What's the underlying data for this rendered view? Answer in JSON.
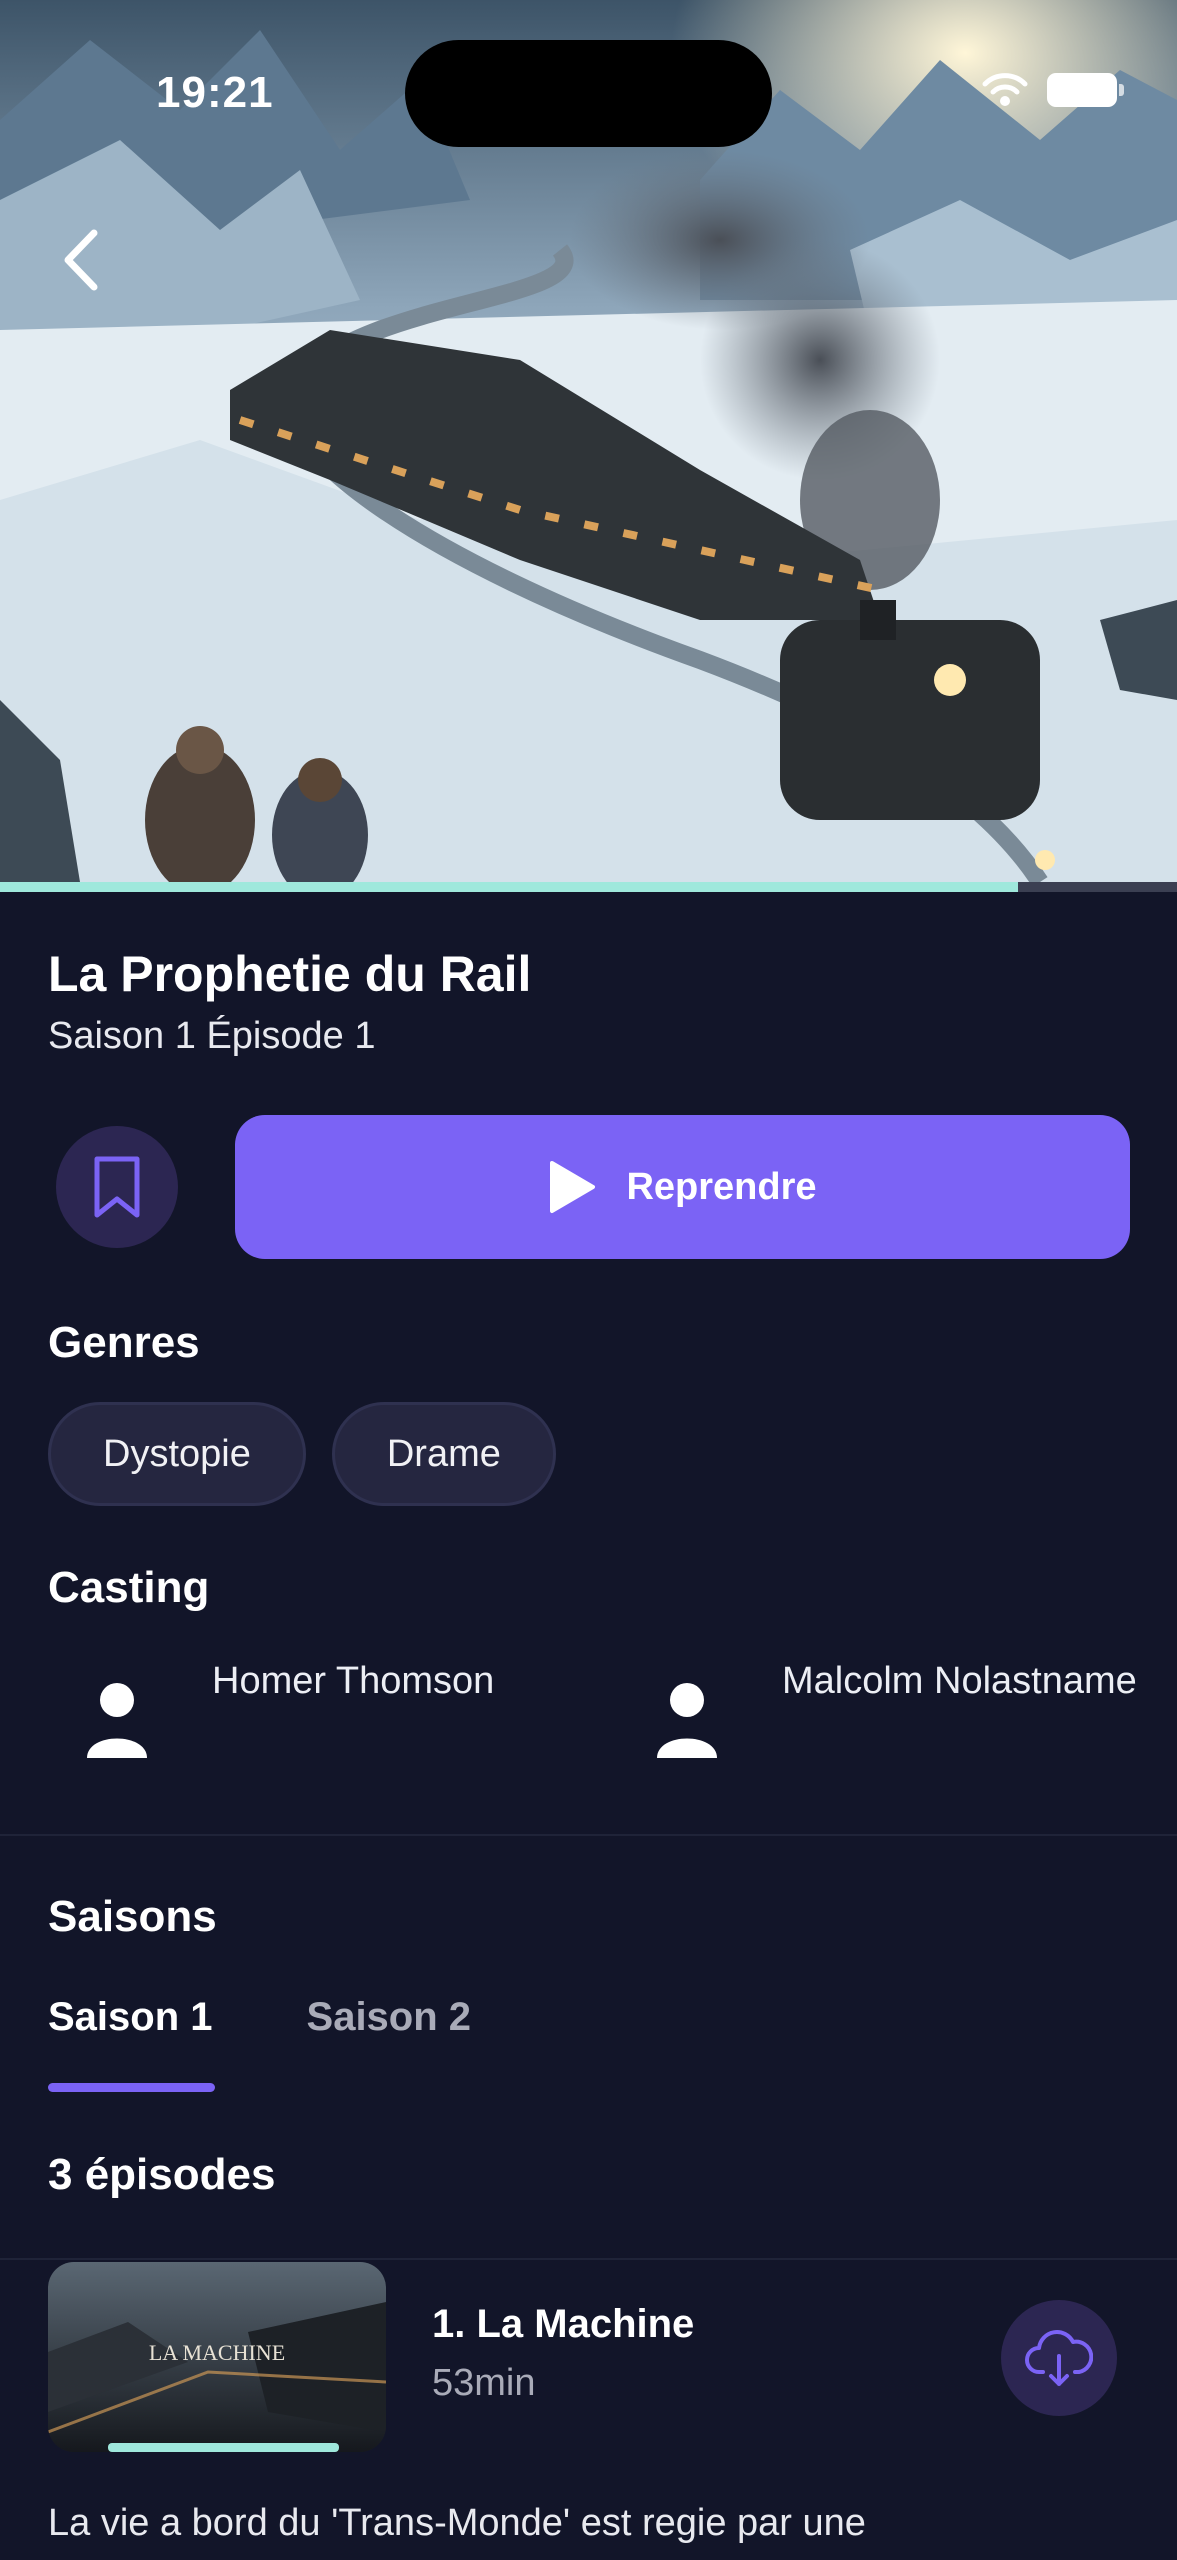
{
  "status_bar": {
    "time": "19:21"
  },
  "hero": {
    "watch_progress": 0.865
  },
  "show": {
    "title": "La Prophetie du Rail",
    "subtitle": "Saison 1 Épisode 1"
  },
  "actions": {
    "resume_label": "Reprendre"
  },
  "genres": {
    "heading": "Genres",
    "items": [
      "Dystopie",
      "Drame"
    ]
  },
  "casting": {
    "heading": "Casting",
    "items": [
      "Homer Thomson",
      "Malcolm Nolastname"
    ]
  },
  "seasons": {
    "heading": "Saisons",
    "tabs": [
      "Saison 1",
      "Saison 2"
    ],
    "active_tab": "Saison 1"
  },
  "episodes": {
    "count_label": "3 épisodes",
    "items": [
      {
        "title": "1. La Machine",
        "duration": "53min",
        "thumb_text": "LA MACHINE",
        "watch_progress": 0.83,
        "description": "La vie a bord du 'Trans-Monde' est regie par une"
      }
    ]
  },
  "colors": {
    "background": "#121529",
    "accent": "#7b63f5",
    "progress": "#9fe8dc",
    "icon_button_bg": "#2c2652"
  }
}
